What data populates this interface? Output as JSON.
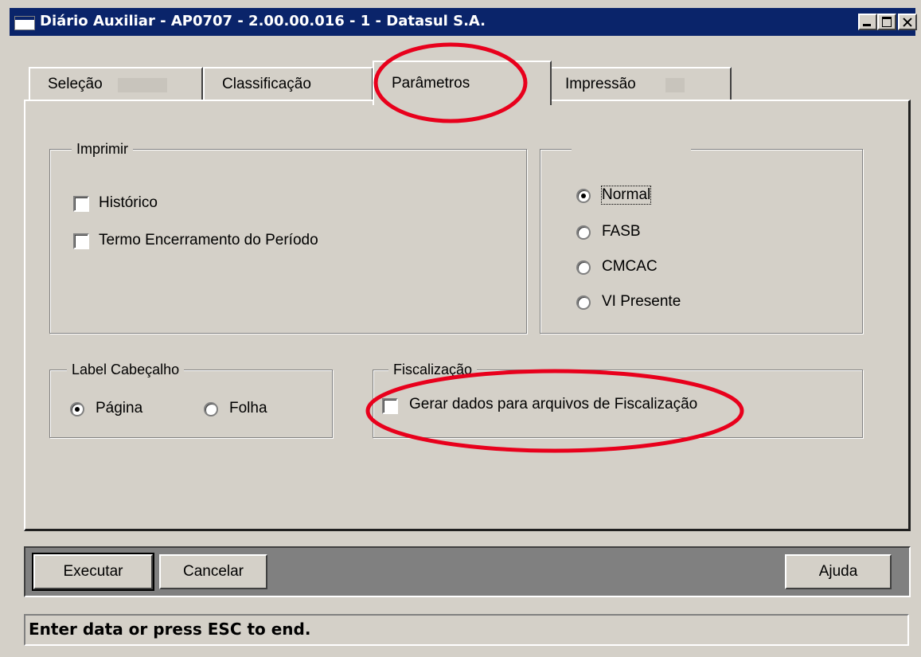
{
  "window": {
    "title": "Diário Auxiliar - AP0707 - 2.00.00.016 - 1 - Datasul S.A.",
    "controls": {
      "minimize": "minimize",
      "maximize": "maximize",
      "close": "close"
    }
  },
  "tabs": [
    {
      "label": "Seleção",
      "selected": false
    },
    {
      "label": "Classificação",
      "selected": false
    },
    {
      "label": "Parâmetros",
      "selected": true
    },
    {
      "label": "Impressão",
      "selected": false
    }
  ],
  "imprimir": {
    "legend": "Imprimir",
    "options": [
      {
        "label": "Histórico",
        "checked": false
      },
      {
        "label": "Termo Encerramento do Período",
        "checked": false
      }
    ]
  },
  "moeda": {
    "legend": "",
    "options": [
      {
        "label": "Normal",
        "selected": true
      },
      {
        "label": "FASB",
        "selected": false
      },
      {
        "label": "CMCAC",
        "selected": false
      },
      {
        "label": "VI Presente",
        "selected": false
      }
    ]
  },
  "label_cabecalho": {
    "legend": "Label Cabeçalho",
    "options": [
      {
        "label": "Página",
        "selected": true
      },
      {
        "label": "Folha",
        "selected": false
      }
    ]
  },
  "fiscalizacao": {
    "legend": "Fiscalização",
    "option": {
      "label": "Gerar dados para arquivos de Fiscalização",
      "checked": false
    }
  },
  "buttons": {
    "executar": "Executar",
    "cancelar": "Cancelar",
    "ajuda": "Ajuda"
  },
  "status": "Enter data or press ESC to end.",
  "colors": {
    "title_bar": "#0a246a",
    "face": "#d4d0c8",
    "annotation": "#e8001c"
  }
}
